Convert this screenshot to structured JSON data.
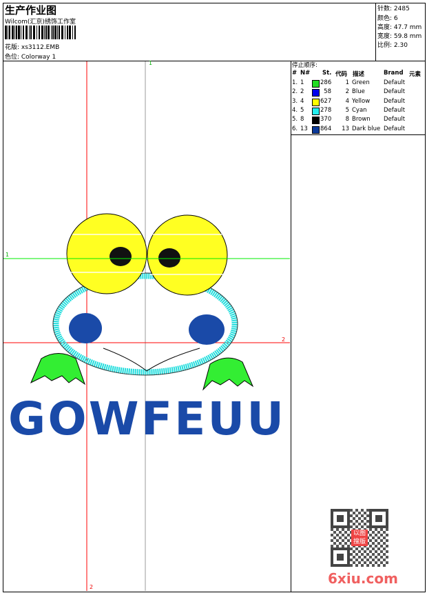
{
  "header": {
    "title": "生产作业图",
    "company": "Wilcom(汇京)绣饰工作室",
    "design_label": "花版: xs3112.EMB",
    "colorway_label": "色位: Colorway 1"
  },
  "info": {
    "stitches": "针数: 2485",
    "colors": "颜色: 6",
    "height": "高度: 47.7 mm",
    "width": "宽度: 59.8 mm",
    "scale": "比例: 2.30"
  },
  "stop_sequence": {
    "title": "停止顺序:",
    "columns": [
      "#",
      "N#",
      "St.",
      "代码",
      "描述",
      "Brand",
      "元素"
    ],
    "rows": [
      {
        "idx": "1.",
        "n": "1",
        "color": "#22dd22",
        "st": "286",
        "code": "1",
        "desc": "Green",
        "brand": "Default"
      },
      {
        "idx": "2.",
        "n": "2",
        "color": "#0000ee",
        "st": "58",
        "code": "2",
        "desc": "Blue",
        "brand": "Default"
      },
      {
        "idx": "3.",
        "n": "4",
        "color": "#ffff00",
        "st": "627",
        "code": "4",
        "desc": "Yellow",
        "brand": "Default"
      },
      {
        "idx": "4.",
        "n": "5",
        "color": "#22eeee",
        "st": "278",
        "code": "5",
        "desc": "Cyan",
        "brand": "Default"
      },
      {
        "idx": "5.",
        "n": "8",
        "color": "#000000",
        "st": "370",
        "code": "8",
        "desc": "Brown",
        "brand": "Default"
      },
      {
        "idx": "6.",
        "n": "13",
        "color": "#0b3a9a",
        "st": "864",
        "code": "13",
        "desc": "Dark blue",
        "brand": "Default"
      }
    ]
  },
  "guides": {
    "v1": "1",
    "h1": "1",
    "h2": "2",
    "v2": "2"
  },
  "watermark": {
    "stamp": "以图搜版",
    "site": "6xiu.com"
  },
  "embroidery_text": "GOWFEUU"
}
